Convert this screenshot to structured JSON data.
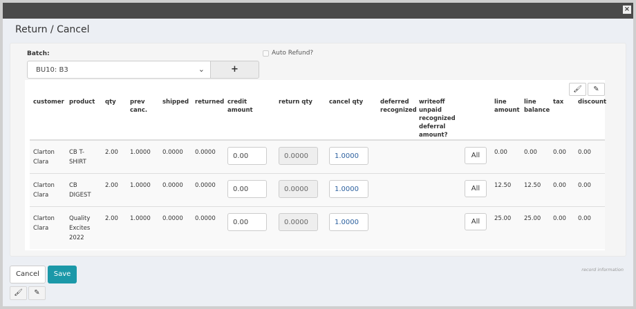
{
  "window": {
    "close_label": "×"
  },
  "title": "Return / Cancel",
  "batch": {
    "label": "Batch:",
    "value": "BU10: B3",
    "add_label": "+"
  },
  "auto_refund": {
    "label": "Auto Refund?",
    "checked": false
  },
  "table": {
    "headers": [
      "customer",
      "product",
      "qty",
      "prev canc.",
      "shipped",
      "returned",
      "credit amount",
      "return qty",
      "cancel qty",
      "deferred recognized",
      "writeoff unpaid recognized deferral amount?",
      "",
      "line amount",
      "line balance",
      "tax",
      "discount"
    ],
    "rows": [
      {
        "customer": "Clarton Clara",
        "product": "CB T-SHIRT",
        "qty": "2.00",
        "prev_canc": "1.0000",
        "shipped": "0.0000",
        "returned": "0.0000",
        "credit_amount": "0.00",
        "return_qty": "0.0000",
        "cancel_qty": "1.0000",
        "all_label": "All",
        "line_amount": "0.00",
        "line_balance": "0.00",
        "tax": "0.00",
        "discount": "0.00"
      },
      {
        "customer": "Clarton Clara",
        "product": "CB DIGEST",
        "qty": "2.00",
        "prev_canc": "1.0000",
        "shipped": "0.0000",
        "returned": "0.0000",
        "credit_amount": "0.00",
        "return_qty": "0.0000",
        "cancel_qty": "1.0000",
        "all_label": "All",
        "line_amount": "12.50",
        "line_balance": "12.50",
        "tax": "0.00",
        "discount": "0.00"
      },
      {
        "customer": "Clarton Clara",
        "product": "Quality Excites 2022",
        "qty": "2.00",
        "prev_canc": "1.0000",
        "shipped": "0.0000",
        "returned": "0.0000",
        "credit_amount": "0.00",
        "return_qty": "0.0000",
        "cancel_qty": "1.0000",
        "all_label": "All",
        "line_amount": "25.00",
        "line_balance": "25.00",
        "tax": "0.00",
        "discount": "0.00"
      }
    ]
  },
  "footer": {
    "cancel_label": "Cancel",
    "save_label": "Save",
    "record_info": "record information"
  },
  "colors": {
    "header_bar": "#4a4a4a",
    "save": "#1b98a8",
    "background": "#eceff4"
  }
}
